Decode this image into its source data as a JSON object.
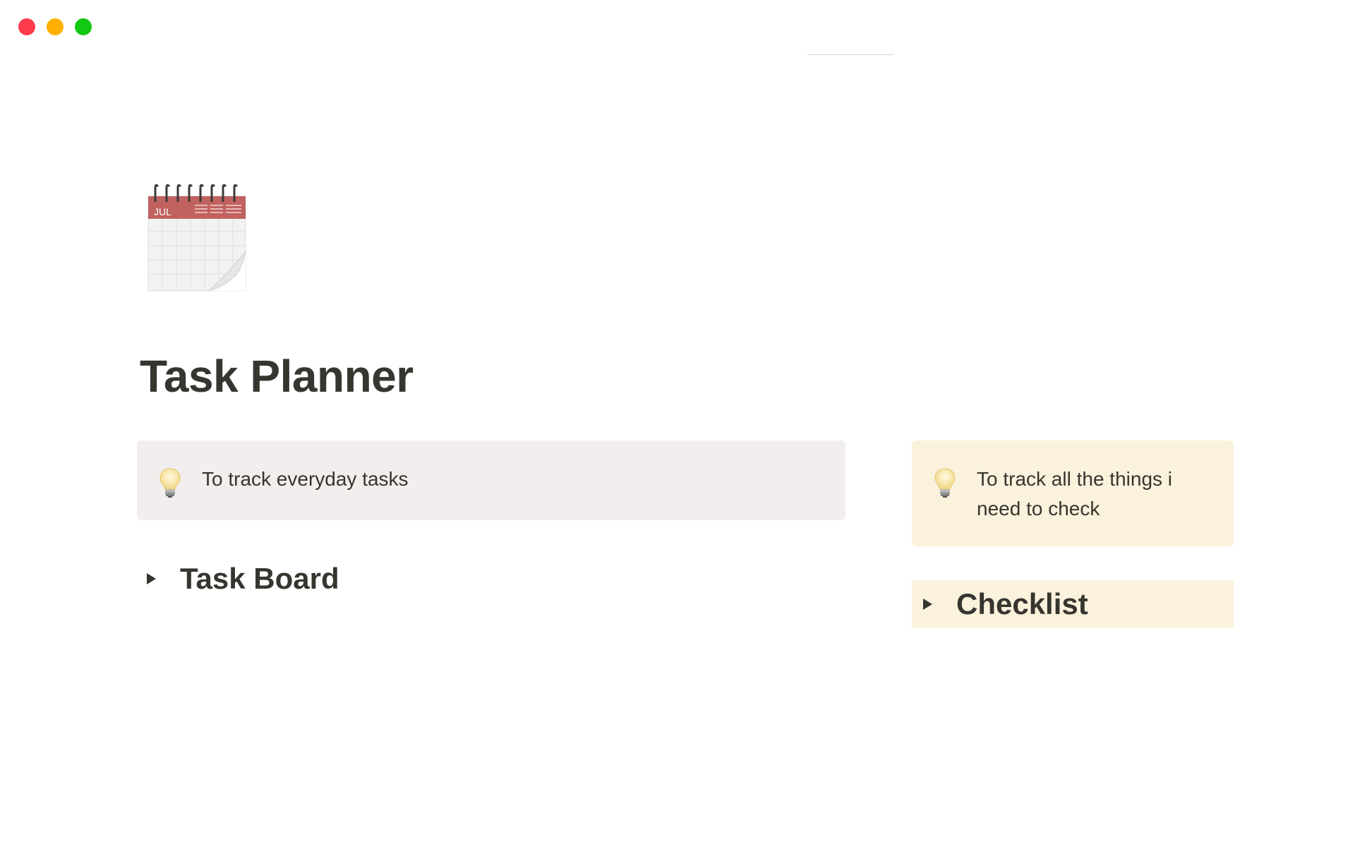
{
  "window": {
    "traffic_lights": [
      "close",
      "minimize",
      "maximize"
    ]
  },
  "page": {
    "icon": "calendar-icon",
    "icon_month": "JUL",
    "title": "Task Planner"
  },
  "callouts": [
    {
      "icon": "lightbulb-icon",
      "text": "To track everyday tasks",
      "background": "#f1eeed"
    },
    {
      "icon": "lightbulb-icon",
      "text": "To track all the things i need to check",
      "background": "#faf2dc"
    }
  ],
  "toggles": [
    {
      "label": "Task Board"
    },
    {
      "label": "Checklist",
      "background": "#faf2dc"
    }
  ],
  "colors": {
    "text": "#37352f",
    "close": "#ff3b4e",
    "minimize": "#ffb000",
    "maximize": "#12c812"
  }
}
